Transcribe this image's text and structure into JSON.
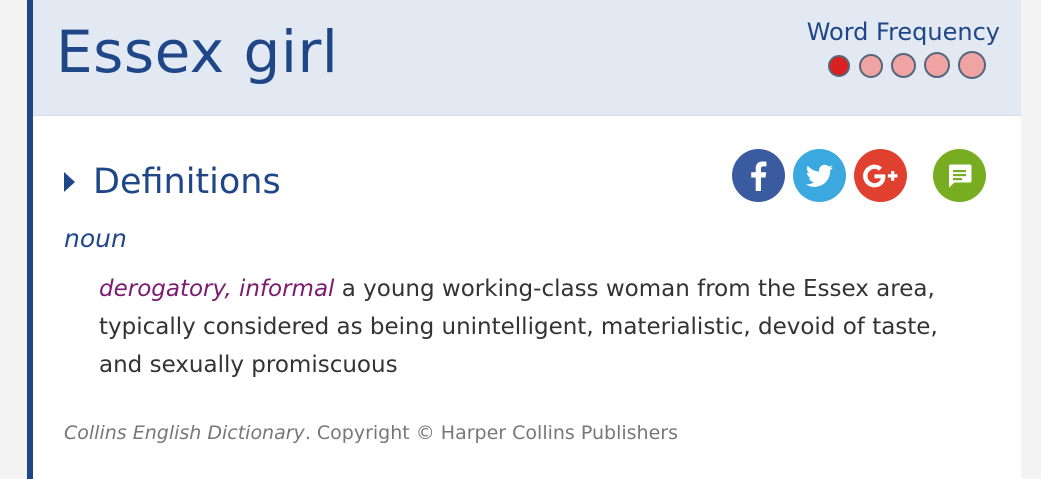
{
  "entry": {
    "headword": "Essex girl",
    "frequency": {
      "label": "Word Frequency",
      "level": 1,
      "max": 5,
      "colors": {
        "active": "#d92020",
        "inactive": "#f0a3a3"
      }
    }
  },
  "definitions": {
    "title": "Definitions",
    "part_of_speech": "noun",
    "sense": {
      "register": "derogatory, informal",
      "text": " a young working-class woman from the Essex area, typically considered as being unintelligent, materialistic, devoid of taste, and sexually promiscuous"
    }
  },
  "share": [
    {
      "name": "facebook-share-button",
      "icon": "facebook-icon",
      "color": "#3b5ba0"
    },
    {
      "name": "twitter-share-button",
      "icon": "twitter-icon",
      "color": "#3ba9e0"
    },
    {
      "name": "google-plus-share-button",
      "icon": "google-plus-icon",
      "color": "#e0402f"
    },
    {
      "name": "comment-button",
      "icon": "comment-icon",
      "color": "#78ad22"
    }
  ],
  "footer": {
    "source": "Collins English Dictionary",
    "copyright": ". Copyright © Harper Collins Publishers"
  },
  "theme": {
    "accent": "#1f4788",
    "header_bg": "#e3e9f3",
    "register_color": "#7b1a6e"
  }
}
